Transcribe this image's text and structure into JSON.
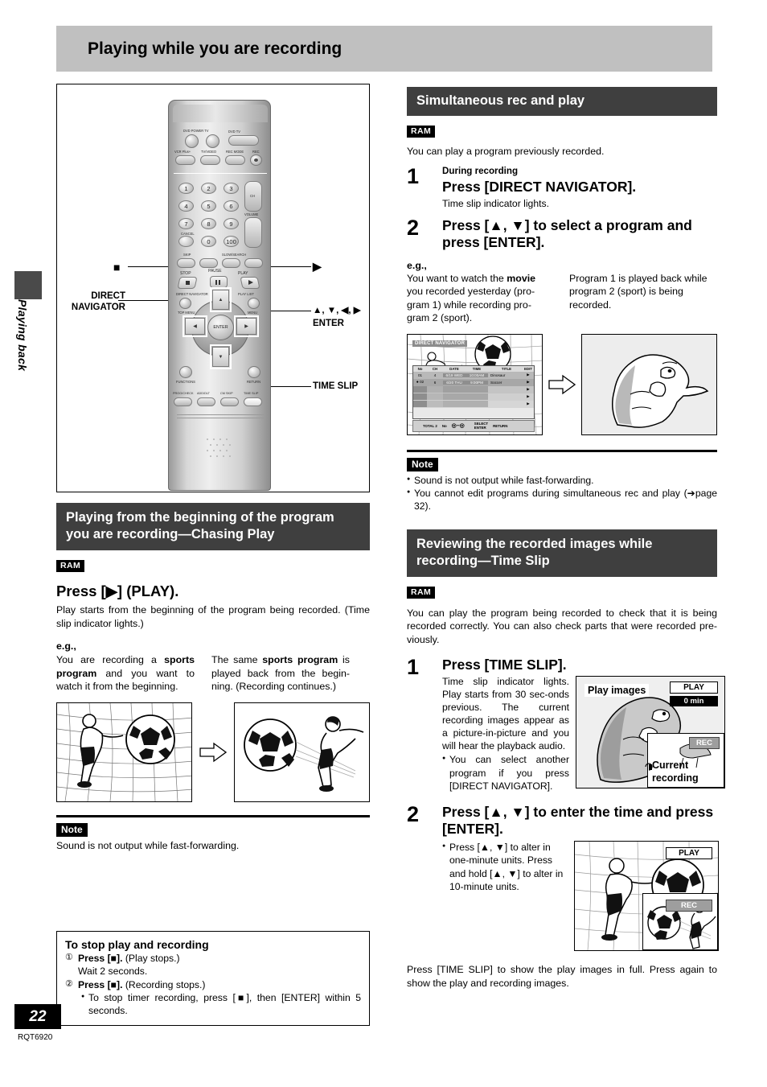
{
  "page": {
    "title": "Playing while you are recording",
    "side_tab": "Playing back",
    "number": "22",
    "code": "RQT6920"
  },
  "remote": {
    "callouts": {
      "stop_icon": "■",
      "play_icon": "▶",
      "direct_navigator": "DIRECT\nNAVIGATOR",
      "arrows_enter": "▲, ▼, ◀, ▶",
      "enter": "ENTER",
      "time_slip": "TIME SLIP"
    },
    "labels": {
      "dvd_power_tv": "DVD POWER TV",
      "dvd_tv_sel": "DVD   TV",
      "vcr_plus": "VCR Plus+",
      "tv_video": "TV/VIDEO",
      "rec_mode": "REC MODE",
      "rec": "REC",
      "ch": "CH",
      "volume": "VOLUME",
      "cancel": "CANCEL",
      "skip": "SKIP",
      "slow_search": "SLOW/SEARCH",
      "stop": "STOP",
      "pause": "PAUSE",
      "play": "PLAY",
      "direct_navigator": "DIRECT NAVIGATOR",
      "play_list": "PLAY LIST",
      "top_menu": "TOP MENU",
      "menu": "MENU",
      "functions": "FUNCTIONS",
      "return": "RETURN",
      "prog_check": "PROG/CHECK",
      "add_dlt": "ADD/DLT",
      "cm_skip": "CM SKIP",
      "time_slip": "TIME SLIP",
      "enter": "ENTER",
      "numbers": [
        "1",
        "2",
        "3",
        "4",
        "5",
        "6",
        "7",
        "8",
        "9",
        "0",
        "100"
      ],
      "power_symbol": "⏻"
    }
  },
  "chasing": {
    "heading": "Playing from the beginning of the program you are recording—Chasing Play",
    "ram": "RAM",
    "action": "Press [▶] (PLAY).",
    "action_desc": "Play starts from the beginning of the program being recorded. (Time slip indicator lights.)",
    "eg_label": "e.g.,",
    "eg_left_parts": [
      "You are recording a ",
      "sports program",
      " and you want to watch it from the beginning."
    ],
    "eg_right_parts": [
      "The same ",
      "sports program",
      " is played back from the begin-ning. (Recording continues.)"
    ],
    "note_badge": "Note",
    "note_text": "Sound is not output while fast-forwarding."
  },
  "stop_box": {
    "title": "To stop play and recording",
    "items": [
      {
        "num": "①",
        "bold": "Press [■].",
        "rest": " (Play stops.)",
        "sub": "Wait 2 seconds."
      },
      {
        "num": "②",
        "bold": "Press [■].",
        "rest": " (Recording stops.)",
        "sub": ""
      }
    ],
    "bullet": "To stop timer recording, press [■], then [ENTER] within 5 seconds."
  },
  "simultaneous": {
    "heading": "Simultaneous rec and play",
    "ram": "RAM",
    "intro": "You can play a program previously recorded.",
    "steps": [
      {
        "num": "1",
        "small": "During recording",
        "head": "Press [DIRECT NAVIGATOR].",
        "sub": "Time slip indicator lights."
      },
      {
        "num": "2",
        "small": "",
        "head": "Press [▲, ▼] to select a program and press [ENTER].",
        "sub": ""
      }
    ],
    "eg_label": "e.g.,",
    "eg_left_parts": [
      "You want to watch the ",
      "movie",
      " you recorded yesterday (pro-gram 1) while recording pro-gram 2 (sport)."
    ],
    "eg_right": "Program 1 is played back while program 2 (sport) is being recorded.",
    "dn_screen": {
      "title": "DIRECT NAVIGATOR",
      "columns": [
        "No",
        "CH",
        "DATE",
        "TIME",
        "TITLE",
        "EDIT"
      ],
      "rows": [
        {
          "marker": "",
          "no": "01",
          "ch": "4",
          "date": "6/19 WED",
          "time": "10:00AM",
          "title": "Dinosaur",
          "edit": "▶"
        },
        {
          "marker": "●",
          "no": "02",
          "ch": "6",
          "date": "6/20 THU",
          "time": "9:00PM",
          "title": "Soccer",
          "edit": "▶"
        }
      ],
      "footer": {
        "total": "TOTAL 2",
        "no": "No",
        "select": "SELECT",
        "enter": "ENTER",
        "return": "RETURN"
      }
    },
    "note_badge": "Note",
    "notes": [
      "Sound is not output while fast-forwarding.",
      "You cannot edit programs during simultaneous rec and play (➔page 32)."
    ]
  },
  "timeslip": {
    "heading": "Reviewing the recorded images while recording—Time Slip",
    "ram": "RAM",
    "intro": "You can play the program being recorded to check that it is being recorded correctly. You can also check parts that were recorded pre-viously.",
    "step1": {
      "num": "1",
      "head": "Press [TIME SLIP].",
      "sub": "Time slip indicator lights. Play starts from 30 sec-onds previous. The current recording images appear as a picture-in-picture and you will hear the playback audio.",
      "bullet": "You can select another program if you press [DIRECT NAVIGATOR]."
    },
    "tv1": {
      "play_images": "Play images",
      "play_tag": "PLAY",
      "time_tag": "0 min",
      "rec_tag": "REC",
      "current_recording": "Current\nrecording"
    },
    "step2": {
      "num": "2",
      "head": "Press [▲, ▼] to enter the time and press [ENTER].",
      "bullet": "Press [▲, ▼] to alter in one-minute units. Press and hold [▲, ▼] to alter in 10-minute units."
    },
    "tv2": {
      "play_tag": "PLAY",
      "rec_tag": "REC"
    },
    "closing": "Press [TIME SLIP] to show the play images in full. Press again to show the play and recording images."
  },
  "colors": {
    "header_band": "#c0c0c0",
    "section_bar": "#3f3f3f",
    "badge": "#000000"
  }
}
